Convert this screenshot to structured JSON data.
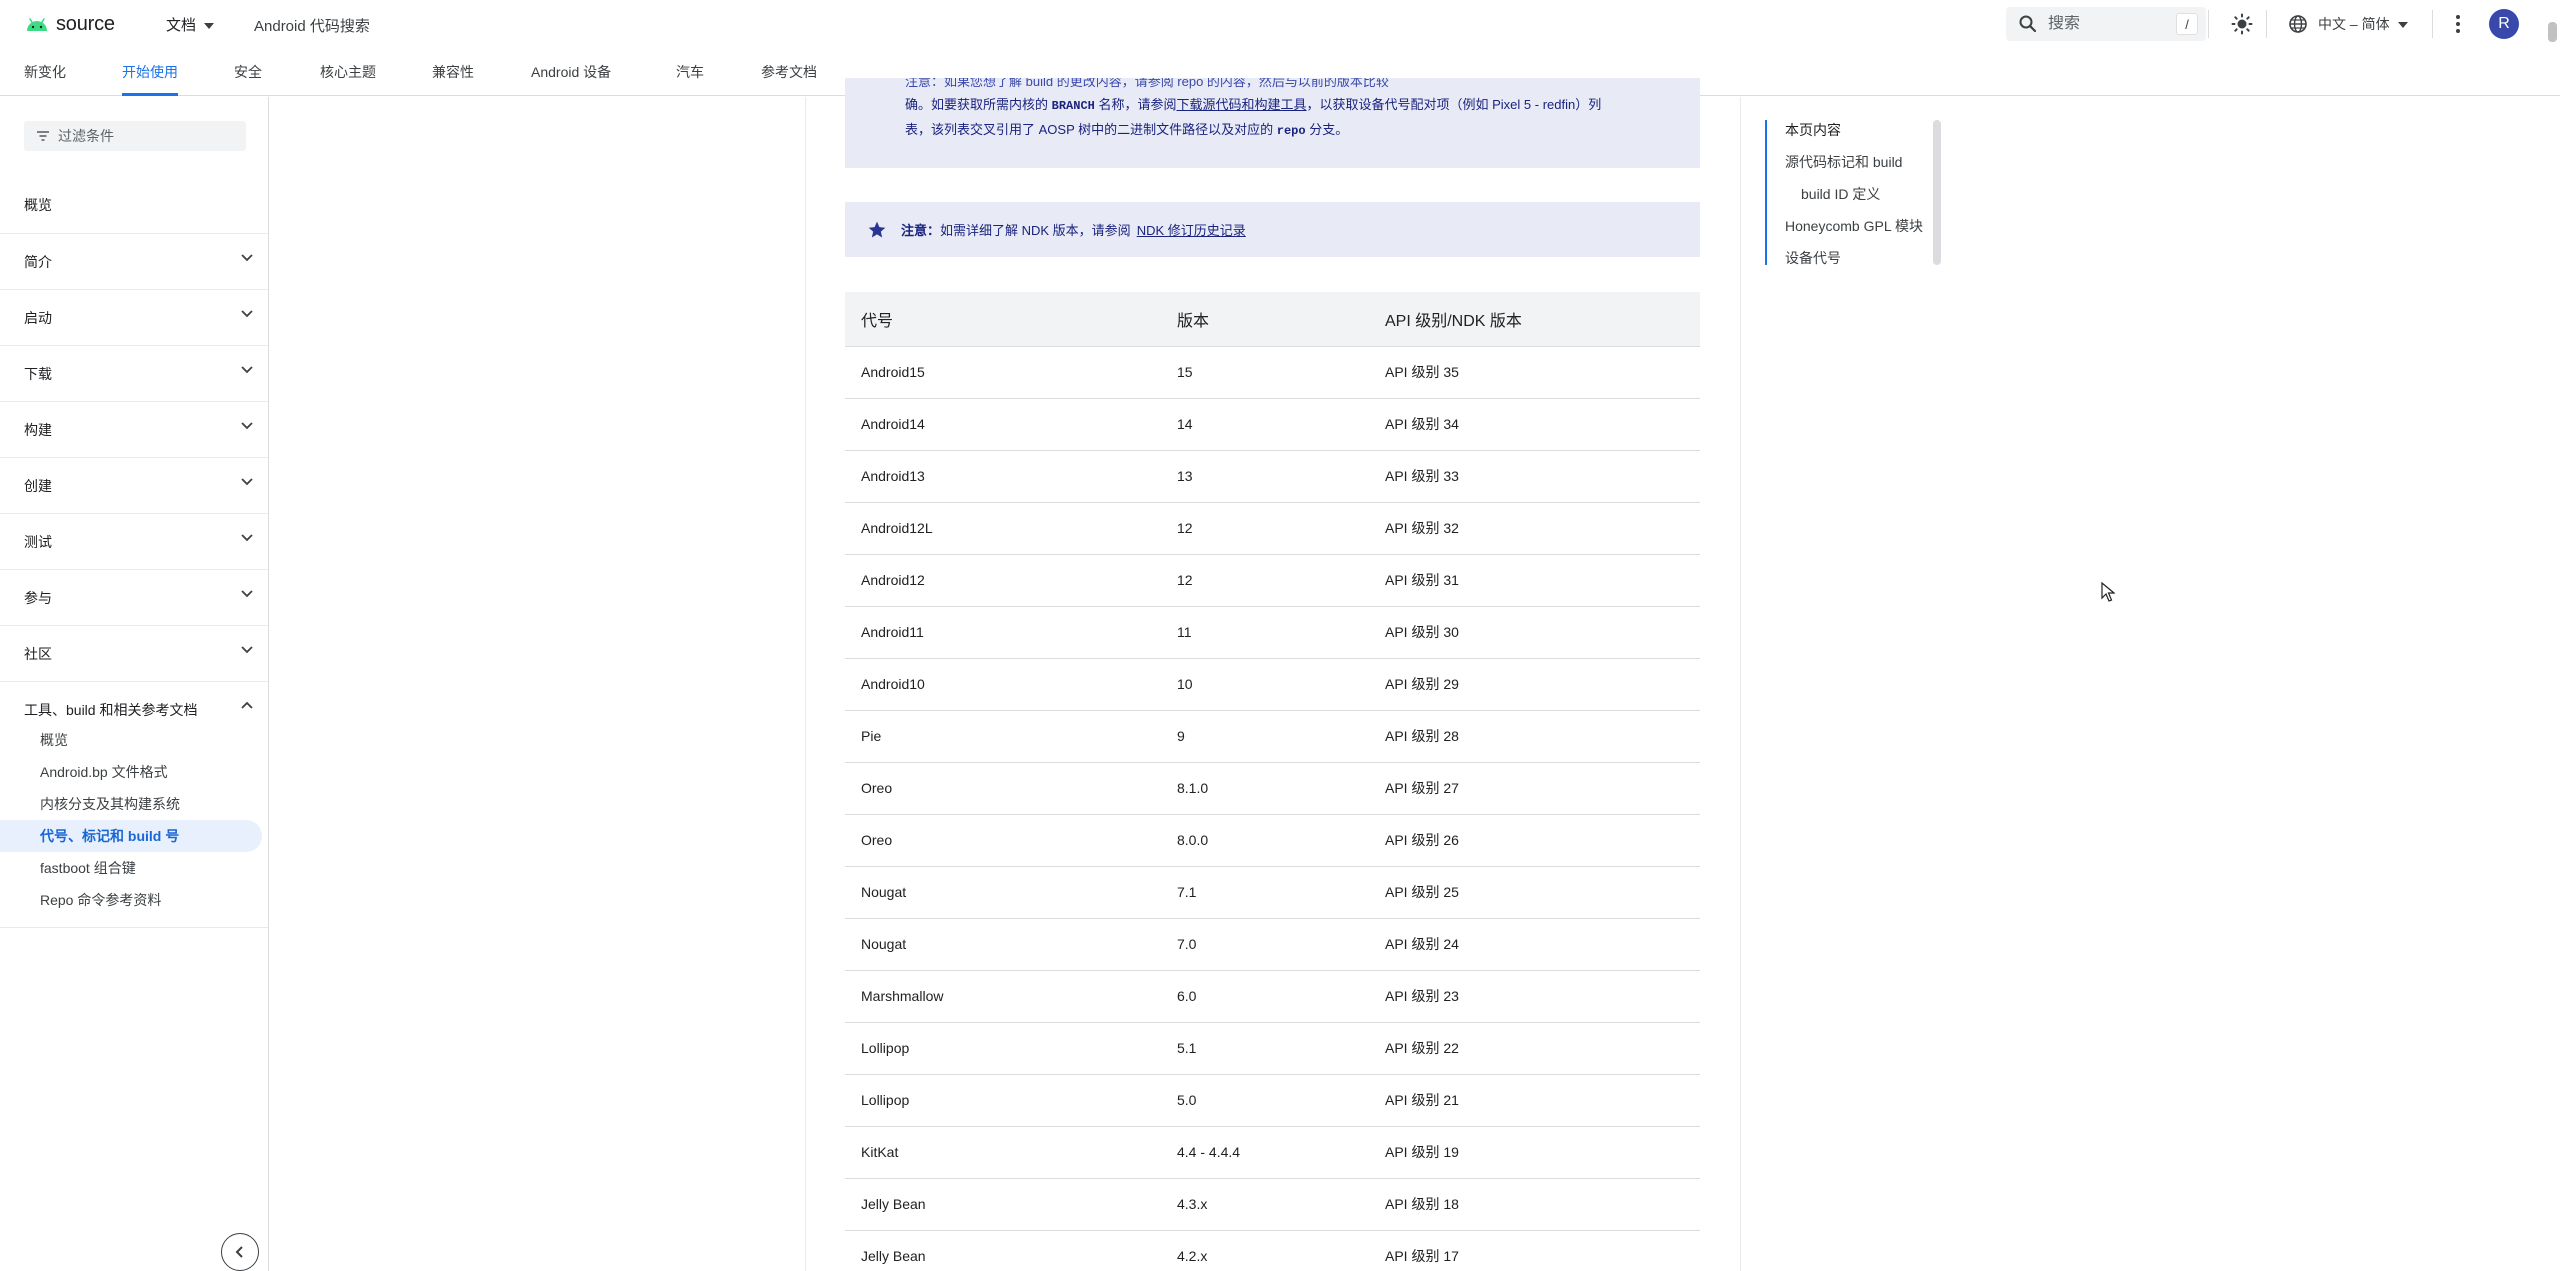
{
  "header": {
    "logo_text": "source",
    "nav_docs": "文档",
    "nav_code_search": "Android 代码搜索",
    "search_placeholder": "搜索",
    "search_shortcut": "/",
    "language": "中文 – 简体",
    "avatar_letter": "R"
  },
  "tabs": [
    {
      "label": "新变化",
      "active": false
    },
    {
      "label": "开始使用",
      "active": true
    },
    {
      "label": "安全",
      "active": false
    },
    {
      "label": "核心主题",
      "active": false
    },
    {
      "label": "兼容性",
      "active": false
    },
    {
      "label": "Android 设备",
      "active": false
    },
    {
      "label": "汽车",
      "active": false
    },
    {
      "label": "参考文档",
      "active": false
    }
  ],
  "sidebar": {
    "filter_placeholder": "过滤条件",
    "overview": "概览",
    "sections": [
      {
        "label": "简介"
      },
      {
        "label": "启动"
      },
      {
        "label": "下载"
      },
      {
        "label": "构建"
      },
      {
        "label": "创建"
      },
      {
        "label": "测试"
      },
      {
        "label": "参与"
      },
      {
        "label": "社区"
      }
    ],
    "expanded_section": "工具、build 和相关参考文档",
    "sub_items": [
      {
        "label": "概览",
        "active": false
      },
      {
        "label": "Android.bp 文件格式",
        "active": false
      },
      {
        "label": "内核分支及其构建系统",
        "active": false
      },
      {
        "label": "代号、标记和 build 号",
        "active": true
      },
      {
        "label": "fastboot 组合键",
        "active": false
      },
      {
        "label": "Repo 命令参考资料",
        "active": false
      }
    ]
  },
  "notes": {
    "note1_top_fragment": "注意：如果您想了解 build 的更改内容，请参阅 repo 的内容，然后与以前的版本比较",
    "note1_line1": "确。如要获取所需内核的",
    "note1_branch": "BRANCH",
    "note1_line1b": "名称，请参阅",
    "note1_link": "下载源代码和构建工具",
    "note1_line1c": "，以获取设备代号配对项（例如 Pixel 5 - redfin）列",
    "note1_line2a": "表，该列表交叉引用了 AOSP 树中的二进制文件路径以及对应的",
    "note1_repo": "repo",
    "note1_line2b": "分支。",
    "note2_bold": "注意：",
    "note2_text": "如需详细了解 NDK 版本，请参阅",
    "note2_link": "NDK 修订历史记录"
  },
  "table": {
    "headers": [
      "代号",
      "版本",
      "API 级别/NDK 版本"
    ],
    "rows": [
      [
        "Android15",
        "15",
        "API 级别 35"
      ],
      [
        "Android14",
        "14",
        "API 级别 34"
      ],
      [
        "Android13",
        "13",
        "API 级别 33"
      ],
      [
        "Android12L",
        "12",
        "API 级别 32"
      ],
      [
        "Android12",
        "12",
        "API 级别 31"
      ],
      [
        "Android11",
        "11",
        "API 级别 30"
      ],
      [
        "Android10",
        "10",
        "API 级别 29"
      ],
      [
        "Pie",
        "9",
        "API 级别 28"
      ],
      [
        "Oreo",
        "8.1.0",
        "API 级别 27"
      ],
      [
        "Oreo",
        "8.0.0",
        "API 级别 26"
      ],
      [
        "Nougat",
        "7.1",
        "API 级别 25"
      ],
      [
        "Nougat",
        "7.0",
        "API 级别 24"
      ],
      [
        "Marshmallow",
        "6.0",
        "API 级别 23"
      ],
      [
        "Lollipop",
        "5.1",
        "API 级别 22"
      ],
      [
        "Lollipop",
        "5.0",
        "API 级别 21"
      ],
      [
        "KitKat",
        "4.4 - 4.4.4",
        "API 级别 19"
      ],
      [
        "Jelly Bean",
        "4.3.x",
        "API 级别 18"
      ],
      [
        "Jelly Bean",
        "4.2.x",
        "API 级别 17"
      ]
    ]
  },
  "toc": {
    "heading": "本页内容",
    "items": [
      {
        "label": "源代码标记和 build",
        "indent": false
      },
      {
        "label": "build ID 定义",
        "indent": true
      },
      {
        "label": "Honeycomb GPL 模块",
        "indent": false
      },
      {
        "label": "设备代号",
        "indent": false
      }
    ]
  },
  "colors": {
    "accent": "#1a73e8",
    "note_bg": "#e8eaf6",
    "android_green": "#3ddc84",
    "avatar": "#3949ab"
  }
}
